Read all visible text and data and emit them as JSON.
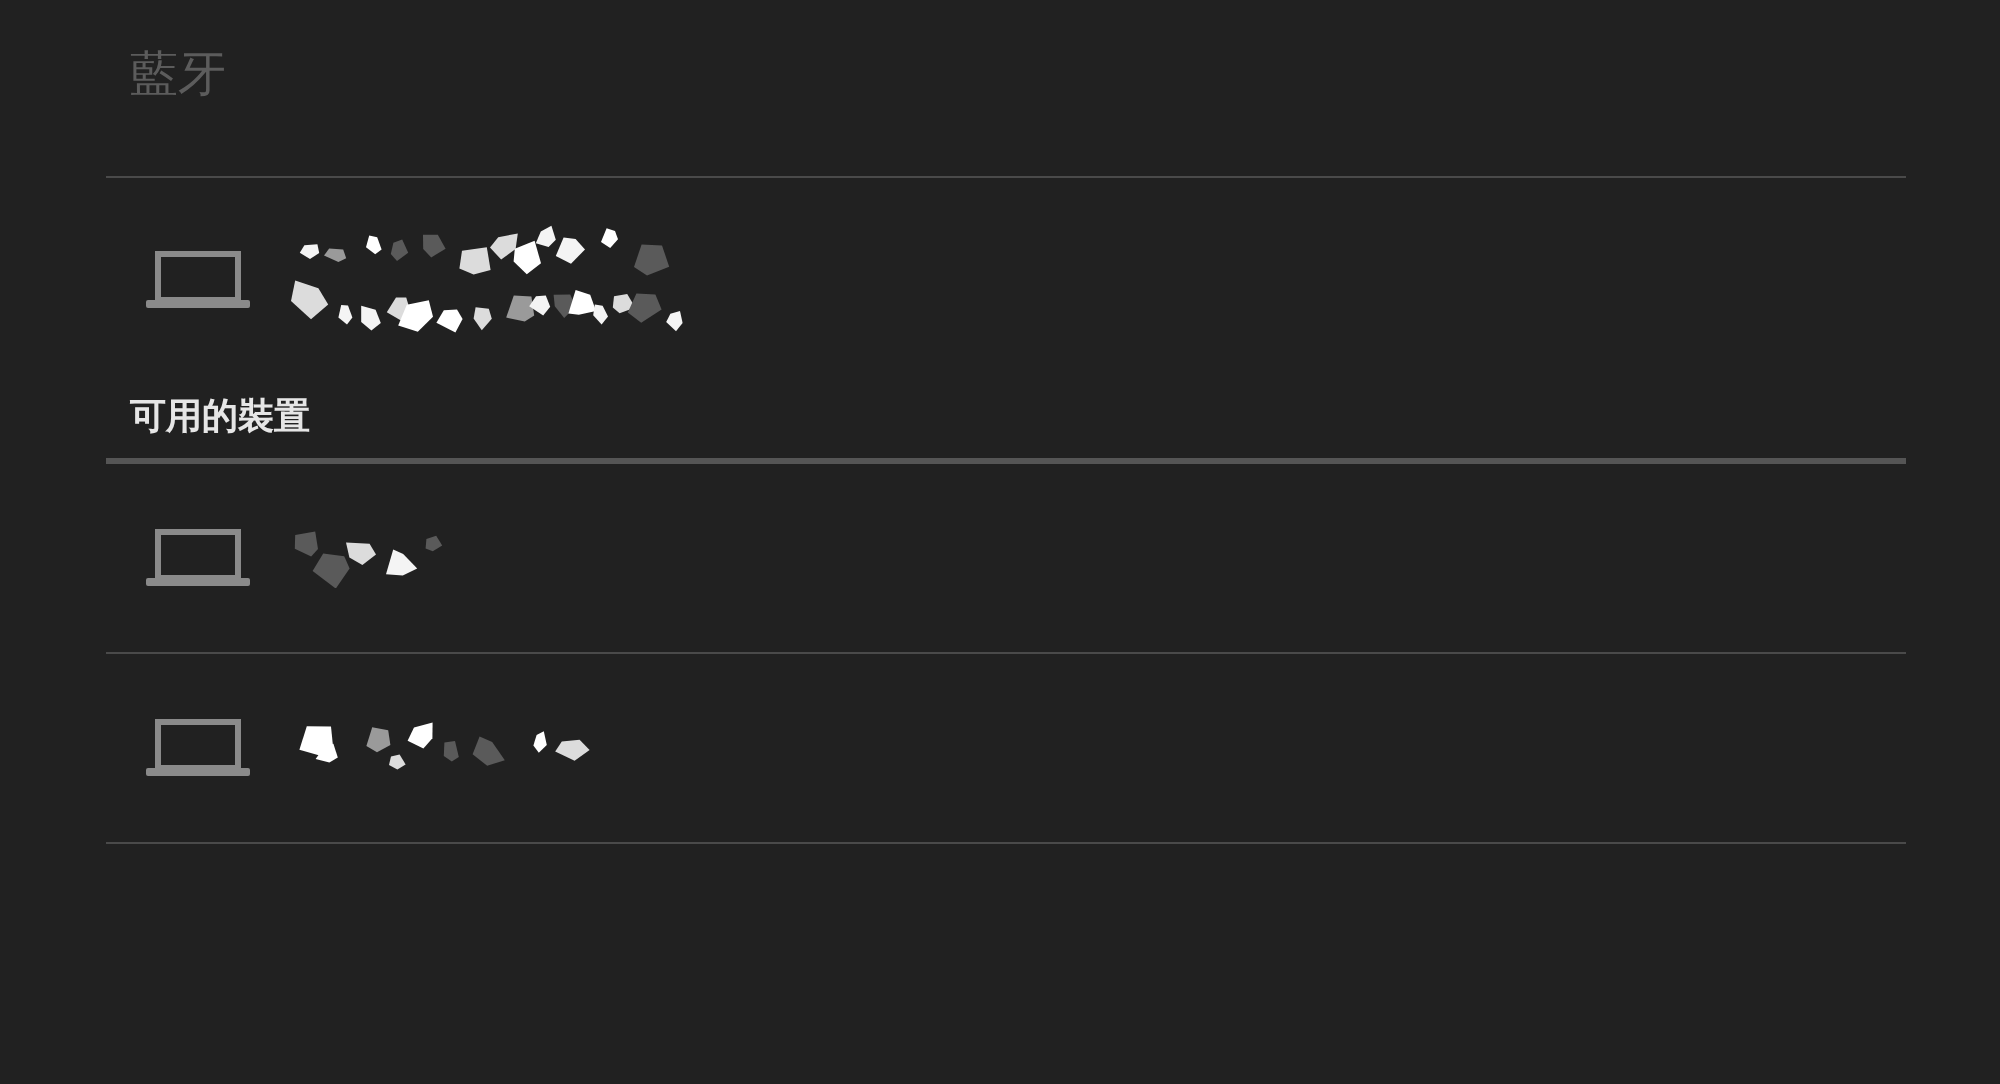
{
  "header": {
    "title": "藍牙"
  },
  "paired_devices": [
    {
      "kind": "obscured"
    }
  ],
  "available_section": {
    "title": "可用的裝置",
    "devices": [
      {
        "kind": "obscured"
      },
      {
        "kind": "obscured"
      }
    ]
  }
}
